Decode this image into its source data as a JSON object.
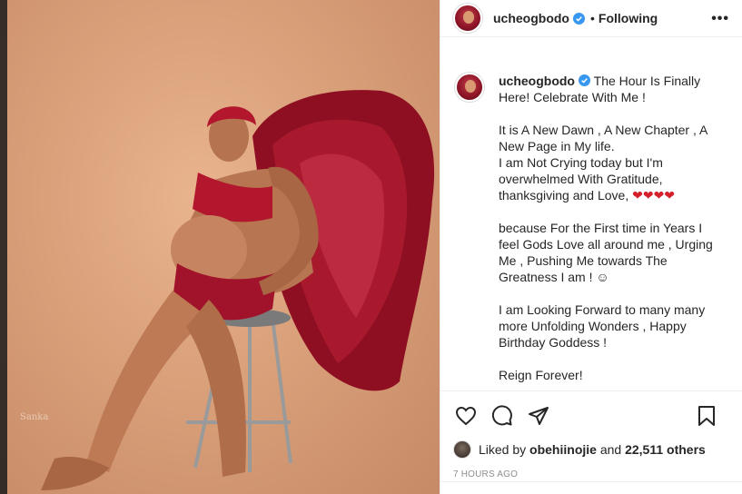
{
  "header": {
    "username": "ucheogbodo",
    "separator": "•",
    "follow_state": "Following",
    "more_label": "•••"
  },
  "photo": {
    "watermark": "Sanka"
  },
  "caption": {
    "username": "ucheogbodo",
    "first_line": "The Hour Is Finally Here! Celebrate With Me !",
    "paragraphs": [
      "It is A New Dawn , A New Chapter , A New Page in My life.\nI am Not Crying today but I'm overwhelmed With Gratitude, thanksgiving and Love, ",
      "because For the First time in Years I feel Gods Love all around me , Urging Me , Pushing Me towards The Greatness I am ! ",
      "I am Looking Forward to many many more Unfolding Wonders , Happy Birthday Goddess !",
      "Reign Forever!"
    ],
    "hearts": "❤❤❤❤",
    "emoji": "☺"
  },
  "likes": {
    "prefix": "Liked by",
    "user": "obehiinojie",
    "connector": "and",
    "others": "22,511 others"
  },
  "timestamp": "7 hours ago",
  "colors": {
    "verified": "#3897f0",
    "heart": "#d51f2a",
    "muted": "#8e8e8e"
  }
}
